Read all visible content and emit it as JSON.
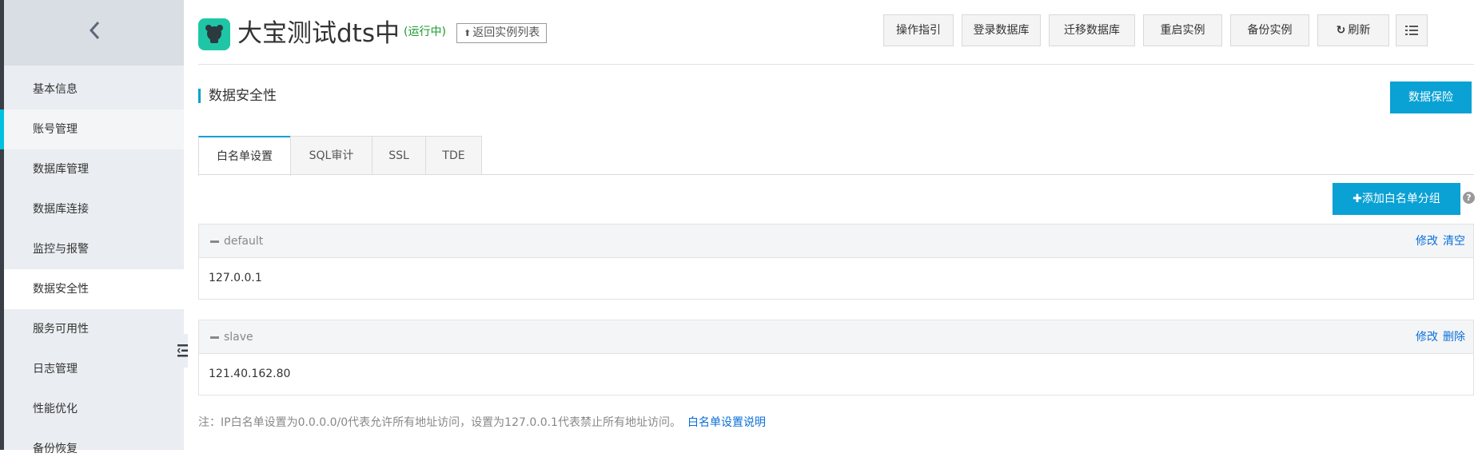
{
  "app": {
    "title": "大宝测试dts中",
    "status": "(运行中)",
    "back_label": "返回实例列表"
  },
  "toolbar": {
    "buttons": [
      "操作指引",
      "登录数据库",
      "迁移数据库",
      "重启实例",
      "备份实例"
    ],
    "refresh_label": "刷新"
  },
  "sidebar": {
    "items": [
      {
        "label": "基本信息"
      },
      {
        "label": "账号管理"
      },
      {
        "label": "数据库管理"
      },
      {
        "label": "数据库连接"
      },
      {
        "label": "监控与报警"
      },
      {
        "label": "数据安全性"
      },
      {
        "label": "服务可用性"
      },
      {
        "label": "日志管理"
      },
      {
        "label": "性能优化"
      },
      {
        "label": "备份恢复"
      }
    ],
    "active_index": 5,
    "hover_index": 1
  },
  "section": {
    "title": "数据安全性",
    "insure_label": "数据保险"
  },
  "tabs": [
    {
      "label": "白名单设置"
    },
    {
      "label": "SQL审计"
    },
    {
      "label": "SSL"
    },
    {
      "label": "TDE"
    }
  ],
  "whitelist": {
    "add_label": "添加白名单分组",
    "help": "?",
    "groups": [
      {
        "name": "default",
        "ips": "127.0.0.1",
        "actions": [
          "修改",
          "清空"
        ]
      },
      {
        "name": "slave",
        "ips": "121.40.162.80",
        "actions": [
          "修改",
          "删除"
        ]
      }
    ],
    "note": "注：IP白名单设置为0.0.0.0/0代表允许所有地址访问，设置为127.0.0.1代表禁止所有地址访问。",
    "note_link": "白名单设置说明"
  },
  "colors": {
    "accent": "#0aa1d4",
    "link": "#0a6fd8",
    "status": "#1a9a2c",
    "logo": "#1fc6a6"
  }
}
